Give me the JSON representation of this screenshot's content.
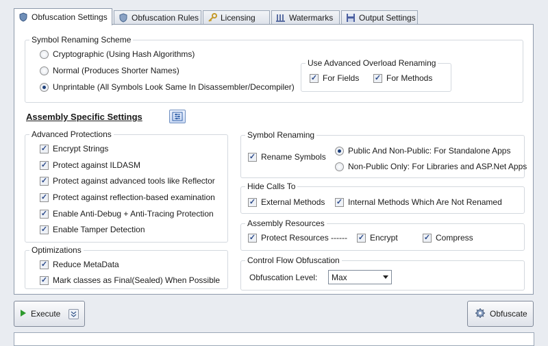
{
  "tabs": [
    {
      "label": "Obfuscation Settings",
      "icon": "shield-icon"
    },
    {
      "label": "Obfuscation Rules",
      "icon": "rules-icon"
    },
    {
      "label": "Licensing",
      "icon": "key-icon"
    },
    {
      "label": "Watermarks",
      "icon": "watermark-icon"
    },
    {
      "label": "Output Settings",
      "icon": "save-icon"
    }
  ],
  "symbol_renaming_scheme": {
    "title": "Symbol Renaming Scheme",
    "options": [
      {
        "label": "Cryptographic (Using Hash Algorithms)",
        "selected": false
      },
      {
        "label": "Normal (Produces Shorter Names)",
        "selected": false
      },
      {
        "label": "Unprintable  (All Symbols Look Same In Disassembler/Decompiler)",
        "selected": true
      }
    ],
    "overload": {
      "title": "Use Advanced Overload Renaming",
      "fields": {
        "label": "For Fields",
        "checked": true
      },
      "methods": {
        "label": "For Methods",
        "checked": true
      }
    }
  },
  "assembly_settings": {
    "title": "Assembly Specific Settings",
    "icon": "assembly-settings-icon"
  },
  "advanced_protections": {
    "title": "Advanced Protections",
    "items": [
      {
        "label": "Encrypt Strings",
        "checked": true
      },
      {
        "label": "Protect against ILDASM",
        "checked": true
      },
      {
        "label": "Protect against advanced tools like Reflector",
        "checked": true
      },
      {
        "label": "Protect against reflection-based examination",
        "checked": true
      },
      {
        "label": "Enable Anti-Debug + Anti-Tracing Protection",
        "checked": true
      },
      {
        "label": "Enable Tamper Detection",
        "checked": true
      }
    ]
  },
  "optimizations": {
    "title": "Optimizations",
    "items": [
      {
        "label": "Reduce MetaData",
        "checked": true
      },
      {
        "label": "Mark classes as Final(Sealed) When Possible",
        "checked": true
      }
    ]
  },
  "symbol_renaming": {
    "title": "Symbol Renaming",
    "rename": {
      "label": "Rename Symbols",
      "checked": true
    },
    "options": [
      {
        "label": "Public And Non-Public: For Standalone Apps",
        "selected": true
      },
      {
        "label": "Non-Public Only: For Libraries and ASP.Net Apps",
        "selected": false
      }
    ]
  },
  "hide_calls": {
    "title": "Hide Calls To",
    "external": {
      "label": "External Methods",
      "checked": true
    },
    "internal": {
      "label": "Internal Methods Which Are Not Renamed",
      "checked": true
    }
  },
  "assembly_resources": {
    "title": "Assembly Resources",
    "protect": {
      "label": "Protect Resources ------",
      "checked": true
    },
    "encrypt": {
      "label": "Encrypt",
      "checked": true
    },
    "compress": {
      "label": "Compress",
      "checked": true
    }
  },
  "control_flow": {
    "title": "Control Flow Obfuscation",
    "level_label": "Obfuscation Level:",
    "level_value": "Max"
  },
  "buttons": {
    "execute": "Execute",
    "obfuscate": "Obfuscate"
  },
  "check_glyph": "✓"
}
